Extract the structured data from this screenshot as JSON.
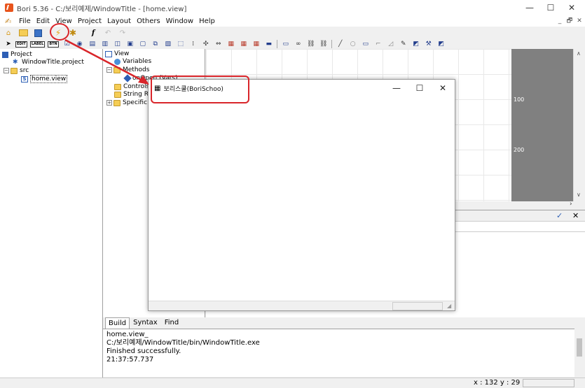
{
  "window": {
    "title": "Bori 5.36 - C:/보리예제/WindowTitle - [home.view]",
    "minimize": "—",
    "maximize": "☐",
    "close": "✕"
  },
  "menu": [
    "File",
    "Edit",
    "View",
    "Project",
    "Layout",
    "Others",
    "Window",
    "Help"
  ],
  "mdi_controls": [
    "_",
    "🗗",
    "✕"
  ],
  "toolbar2_text_buttons": [
    "EDIT",
    "LABEL",
    "BTN"
  ],
  "project_tree": {
    "root": "Project",
    "project_file": "WindowTitle.project",
    "src": "src",
    "view": "home.view"
  },
  "outline_tree": {
    "view": "View",
    "variables": "Variables",
    "methods": "Methods",
    "on_open": "onOpen (Vars)",
    "controls": "Controls",
    "string_res": "String Re",
    "specific": "Specific"
  },
  "ruler": [
    "100",
    "200"
  ],
  "output": {
    "tabs": [
      "Build",
      "Syntax",
      "Find"
    ],
    "lines": [
      "home.view_",
      "C:/보리예제/WindowTitle/bin/WindowTitle.exe",
      "Finished successfully.",
      "21:37:57.737"
    ]
  },
  "status": {
    "coords": "x : 132  y : 29"
  },
  "run_window": {
    "title": "보리스쿨(BoriSchoo)",
    "minimize": "—",
    "maximize": "☐",
    "close": "✕"
  },
  "colors": {
    "annotation": "#d9252a",
    "ruler": "#808080",
    "folder": "#f5cd55"
  }
}
